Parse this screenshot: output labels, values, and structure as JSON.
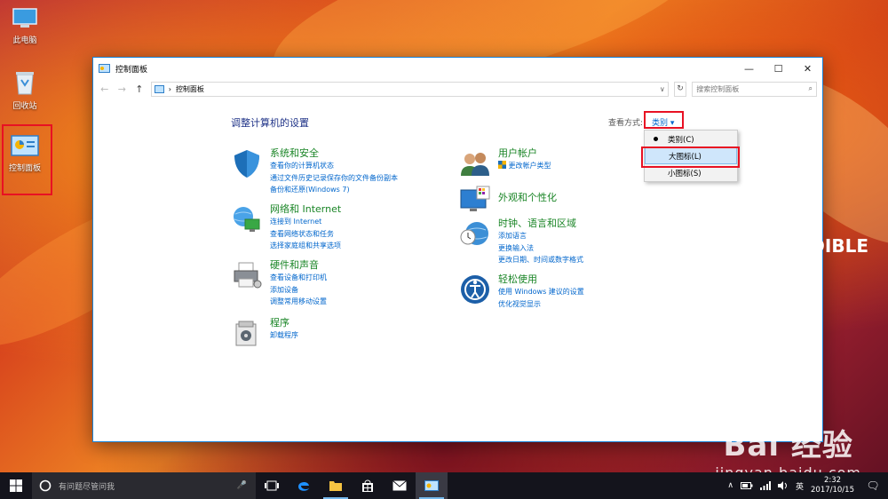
{
  "desktop": {
    "icons": [
      {
        "label": "此电脑"
      },
      {
        "label": "回收站"
      },
      {
        "label": "控制面板"
      }
    ]
  },
  "window": {
    "title": "控制面板",
    "buttons": {
      "minimize": "—",
      "maximize": "☐",
      "close": "✕"
    },
    "nav": {
      "back": "←",
      "forward": "→",
      "up": "↑"
    },
    "address": {
      "separator": "›",
      "crumb": "控制面板",
      "dropdown": "∨",
      "refresh": "↻"
    },
    "search": {
      "placeholder": "搜索控制面板",
      "icon": "⌕"
    }
  },
  "content": {
    "heading": "调整计算机的设置",
    "view_by_label": "查看方式:",
    "view_by_value": "类别 ▾",
    "categories": [
      {
        "title": "系统和安全",
        "icon": "shield-icon",
        "links": [
          "查看你的计算机状态",
          "通过文件历史记录保存你的文件备份副本",
          "备份和还原(Windows 7)"
        ]
      },
      {
        "title": "网络和 Internet",
        "icon": "network-icon",
        "links": [
          "连接到 Internet",
          "查看网络状态和任务",
          "选择家庭组和共享选项"
        ]
      },
      {
        "title": "硬件和声音",
        "icon": "printer-icon",
        "links": [
          "查看设备和打印机",
          "添加设备",
          "调整常用移动设置"
        ]
      },
      {
        "title": "程序",
        "icon": "programs-icon",
        "links": [
          "卸载程序"
        ]
      },
      {
        "title": "用户帐户",
        "icon": "users-icon",
        "links": [
          "更改帐户类型"
        ]
      },
      {
        "title": "外观和个性化",
        "icon": "appearance-icon",
        "links": []
      },
      {
        "title": "时钟、语言和区域",
        "icon": "clock-globe-icon",
        "links": [
          "添加语言",
          "更换输入法",
          "更改日期、时间或数字格式"
        ]
      },
      {
        "title": "轻松使用",
        "icon": "ease-access-icon",
        "links": [
          "使用 Windows 建议的设置",
          "优化视觉显示"
        ]
      }
    ]
  },
  "view_menu": {
    "items": [
      {
        "label": "类别(C)",
        "checked": true
      },
      {
        "label": "大图标(L)",
        "hover": true
      },
      {
        "label": "小图标(S)"
      }
    ]
  },
  "watermark": {
    "logo": "Bai 经验",
    "url": "jingyan.baidu.com",
    "edible": "EDIBLE"
  },
  "taskbar": {
    "search_placeholder": "有问题尽管问我",
    "mic": "🎤",
    "tray": {
      "chevron": "∧",
      "ime": "英",
      "time": "2:32",
      "date": "2017/10/15",
      "notif": "🗨"
    }
  },
  "colors": {
    "accent": "#0066cc",
    "category_title": "#1a8526",
    "heading": "#1e3287",
    "highlight": "#e81123"
  }
}
